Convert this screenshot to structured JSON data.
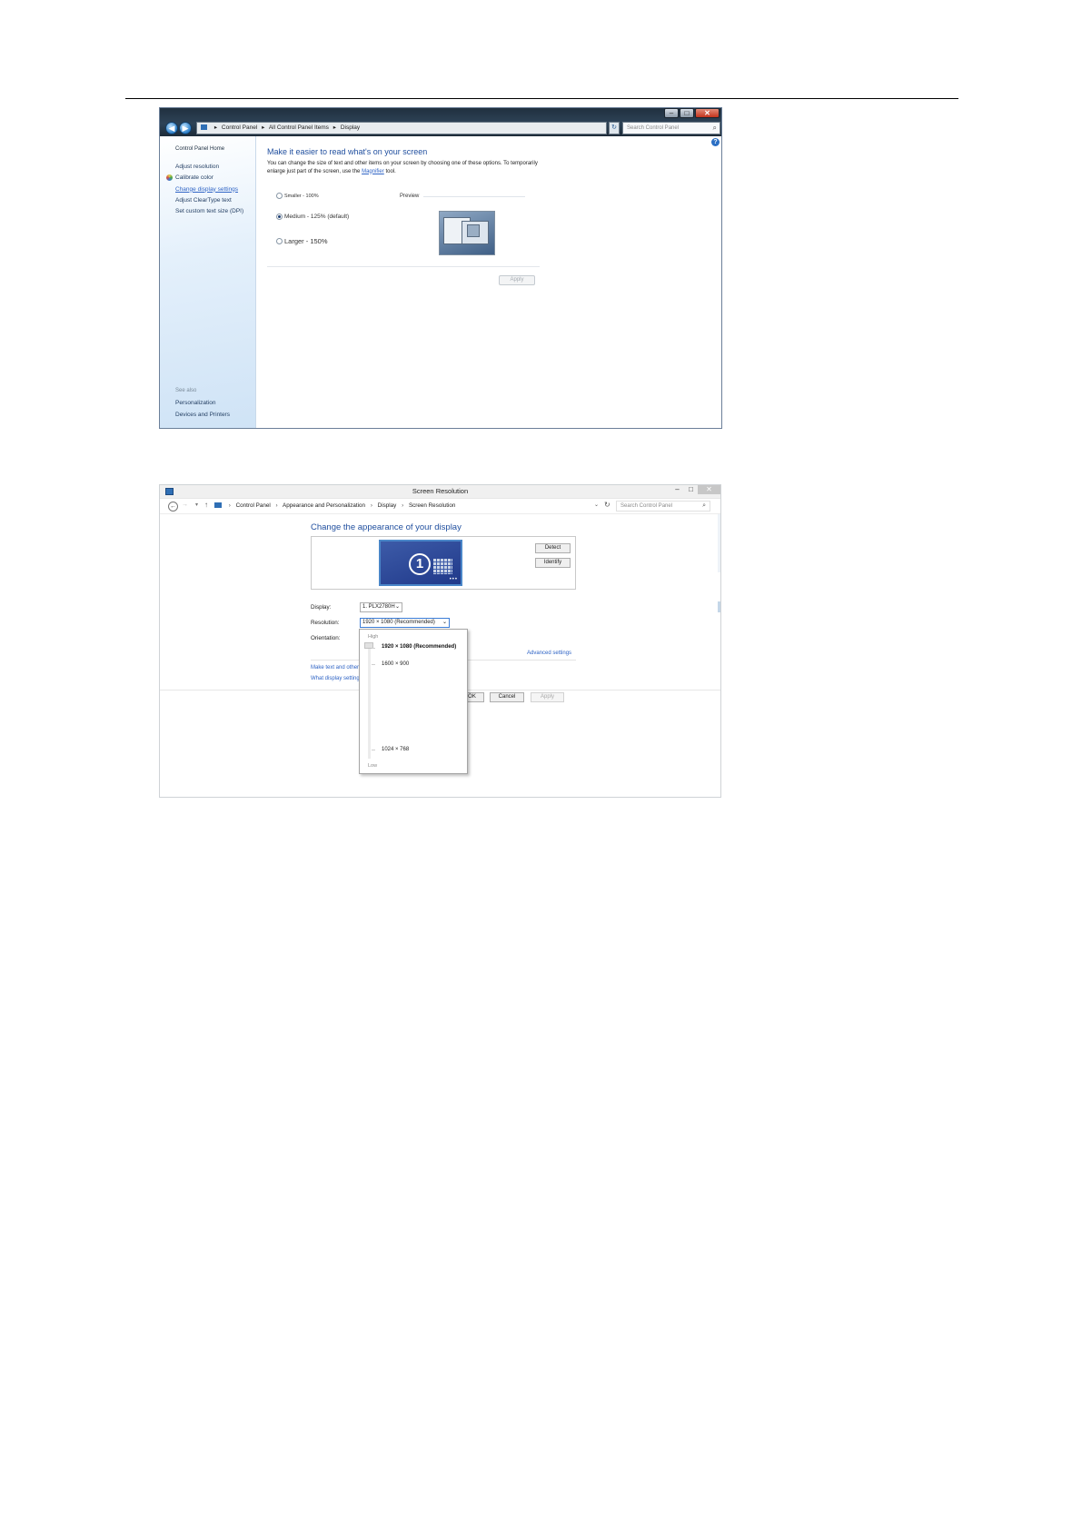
{
  "window1": {
    "address": [
      "Control Panel",
      "All Control Panel Items",
      "Display"
    ],
    "search_placeholder": "Search Control Panel",
    "caption": {
      "minimize": "–",
      "maximize": "□",
      "close": "✕"
    },
    "nav": {
      "back": "◀",
      "forward": "▶",
      "refresh": "↻"
    },
    "sidebar": {
      "home": "Control Panel Home",
      "links": [
        "Adjust resolution",
        "Calibrate color",
        "Change display settings",
        "Adjust ClearType text",
        "Set custom text size (DPI)"
      ],
      "see_also_title": "See also",
      "see_also": [
        "Personalization",
        "Devices and Printers"
      ]
    },
    "help": "?",
    "heading": "Make it easier to read what's on your screen",
    "description_pre": "You can change the size of text and other items on your screen by choosing one of these options. To temporarily enlarge just part of the screen, use the",
    "magnifier_link": "Magnifier",
    "description_post": "tool.",
    "options": [
      "Smaller - 100%",
      "Medium - 125% (default)",
      "Larger - 150%"
    ],
    "selected_option": "Medium - 125% (default)",
    "preview_label": "Preview",
    "apply_label": "Apply"
  },
  "window2": {
    "title": "Screen Resolution",
    "caption": {
      "minimize": "–",
      "maximize": "□",
      "close": "✕"
    },
    "nav": {
      "back": "←",
      "forward": "→",
      "history": "▾",
      "up": "↑",
      "address_dropdown": "⌄",
      "refresh": "↻"
    },
    "address": [
      "Control Panel",
      "Appearance and Personalization",
      "Display",
      "Screen Resolution"
    ],
    "search_placeholder": "Search Control Panel",
    "heading": "Change the appearance of your display",
    "monitor_number": "1",
    "detect_label": "Detect",
    "identify_label": "Identify",
    "display_label": "Display:",
    "display_value": "1. PLX2780H",
    "resolution_label": "Resolution:",
    "resolution_value": "1920 × 1080 (Recommended)",
    "orientation_label": "Orientation:",
    "advanced_link": "Advanced settings",
    "link1": "Make text and other",
    "link2": "What display setting",
    "ok_label": "OK",
    "cancel_label": "Cancel",
    "apply_label": "Apply",
    "dropdown": {
      "high_label": "High",
      "low_label": "Low",
      "options": [
        "1920 × 1080 (Recommended)",
        "1600 × 900",
        "1024 × 768"
      ]
    }
  }
}
